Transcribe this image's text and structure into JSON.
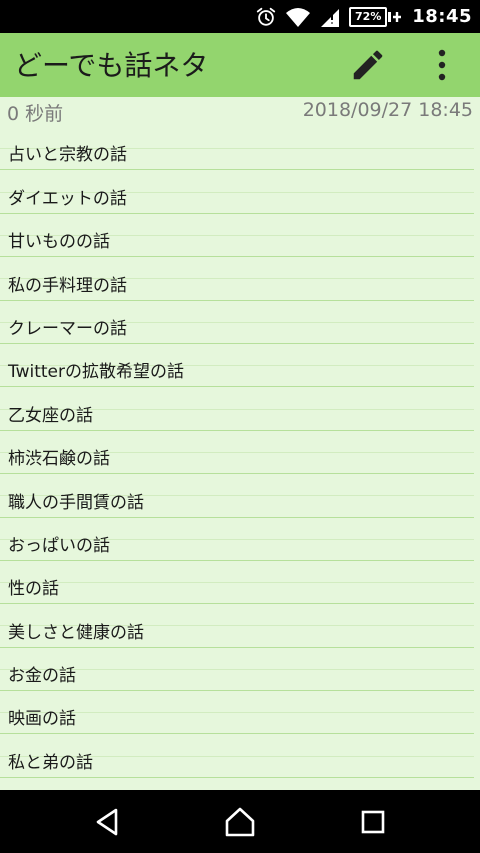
{
  "status": {
    "battery": "72%",
    "time": "18:45"
  },
  "appbar": {
    "title": "どーでも話ネタ",
    "edit_icon": "pencil-icon",
    "more_icon": "more-vert-icon"
  },
  "meta": {
    "elapsed": "0 秒前",
    "datetime": "2018/09/27 18:45"
  },
  "note": {
    "lines": [
      "占いと宗教の話",
      "ダイエットの話",
      "甘いものの話",
      "私の手料理の話",
      "クレーマーの話",
      "Twitterの拡散希望の話",
      "乙女座の話",
      "柿渋石鹸の話",
      "職人の手間賃の話",
      "おっぱいの話",
      "性の話",
      "美しさと健康の話",
      "お金の話",
      "映画の話",
      "私と弟の話"
    ]
  },
  "navbar": {
    "back_icon": "back-icon",
    "home_icon": "home-icon",
    "recents_icon": "recents-icon"
  }
}
